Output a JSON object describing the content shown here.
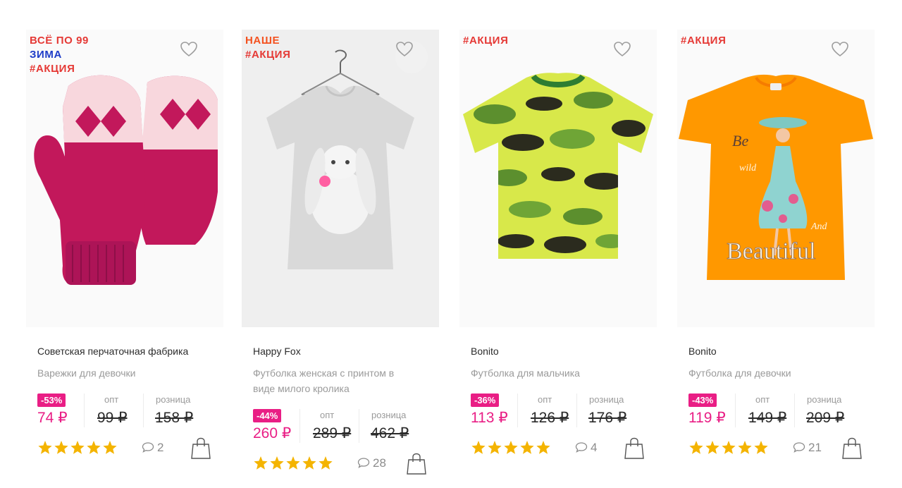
{
  "colors": {
    "accent": "#e91e85",
    "badge_red": "#e53935",
    "badge_blue": "#1e3cc8",
    "star": "#f4b400"
  },
  "products": [
    {
      "badges": [
        {
          "text": "ВСЁ ПО 99",
          "color": "#e53935"
        },
        {
          "text": "ЗИМА",
          "color": "#1e3cc8"
        },
        {
          "text": "#АКЦИЯ",
          "color": "#e53935"
        }
      ],
      "image": "pink-knitted-mittens",
      "brand": "Советская перчаточная фабрика",
      "title": "Варежки для девочки",
      "discount": "-53%",
      "opt_label": "опт",
      "retail_label": "розница",
      "price": "74 ₽",
      "opt_price": "99 ₽",
      "retail_price": "158 ₽",
      "rating": 5,
      "comments": "2"
    },
    {
      "badges": [
        {
          "text": "НАШЕ",
          "color": "#f4511e"
        },
        {
          "text": "#АКЦИЯ",
          "color": "#e53935"
        }
      ],
      "image": "grey-tshirt-bunny-print",
      "brand": "Happy Fox",
      "title": "Футболка женская с принтом в виде милого кролика",
      "discount": "-44%",
      "opt_label": "опт",
      "retail_label": "розница",
      "price": "260 ₽",
      "opt_price": "289 ₽",
      "retail_price": "462 ₽",
      "rating": 5,
      "comments": "28"
    },
    {
      "badges": [
        {
          "text": "#АКЦИЯ",
          "color": "#e53935"
        }
      ],
      "image": "camouflage-tshirt",
      "brand": "Bonito",
      "title": "Футболка для мальчика",
      "discount": "-36%",
      "opt_label": "опт",
      "retail_label": "розница",
      "price": "113 ₽",
      "opt_price": "126 ₽",
      "retail_price": "176 ₽",
      "rating": 5,
      "comments": "4"
    },
    {
      "badges": [
        {
          "text": "#АКЦИЯ",
          "color": "#e53935"
        }
      ],
      "image": "orange-tshirt-beautiful-print",
      "brand": "Bonito",
      "title": "Футболка для девочки",
      "discount": "-43%",
      "opt_label": "опт",
      "retail_label": "розница",
      "price": "119 ₽",
      "opt_price": "149 ₽",
      "retail_price": "209 ₽",
      "rating": 5,
      "comments": "21"
    }
  ]
}
